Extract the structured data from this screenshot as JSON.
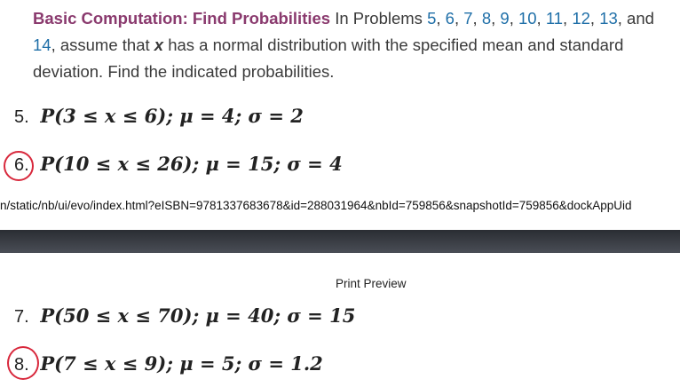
{
  "intro": {
    "heading": "Basic Computation: Find Probabilities",
    "text_before_links": "In Problems",
    "problem_links": [
      "5",
      "6",
      "7",
      "8",
      "9",
      "10",
      "11",
      "12",
      "13",
      "and 14"
    ],
    "text_after_links": ", assume that",
    "variable": "x",
    "text_end": "has a normal distribution with the specified mean and standard deviation. Find the indicated probabilities."
  },
  "problems": [
    {
      "number": "5.",
      "expression": "P(3 ≤ x ≤ 6); μ = 4; σ = 2"
    },
    {
      "number": "6.",
      "expression": "P(10 ≤ x ≤ 26); μ = 15; σ = 4"
    },
    {
      "number": "7.",
      "expression": "P(50 ≤ x ≤ 70); μ = 40; σ = 15"
    },
    {
      "number": "8.",
      "expression": "P(7 ≤ x ≤ 9); μ = 5; σ = 1.2"
    }
  ],
  "url_bar": {
    "text": "n/static/nb/ui/evo/index.html?eISBN=9781337683678&id=288031964&nbId=759856&snapshotId=759856&dockAppUid"
  },
  "print_preview": {
    "label": "Print Preview"
  },
  "colors": {
    "heading": "#8a3a6e",
    "link": "#1f6fa8",
    "annotation": "#d8283c",
    "divider": "#2a2d33"
  }
}
